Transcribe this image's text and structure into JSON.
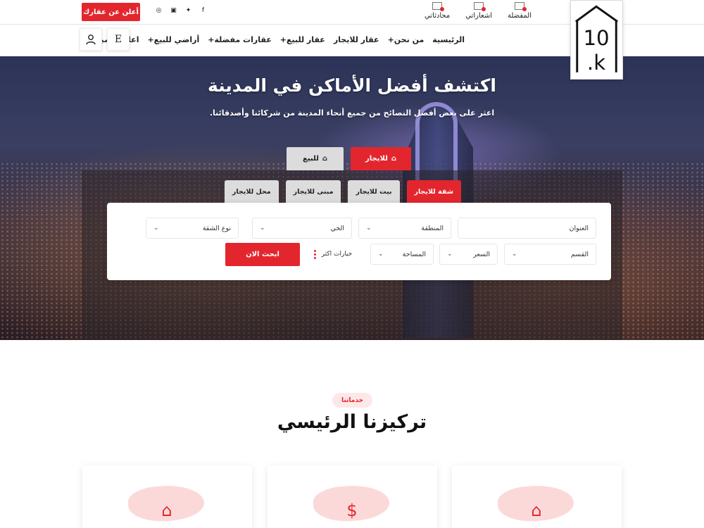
{
  "topbar": {
    "advertise_button": "أعلن عن عقارك",
    "links": [
      {
        "label": "المفضلة",
        "icon": "mail-icon"
      },
      {
        "label": "اشعاراتي",
        "icon": "mail-icon"
      },
      {
        "label": "محادثاتي",
        "icon": "mail-icon"
      }
    ],
    "social": [
      "facebook-icon",
      "twitter-icon",
      "instagram-icon",
      "dribbble-icon"
    ]
  },
  "logo": {
    "text": "10k."
  },
  "nav": {
    "items": [
      "الرئيسية",
      "من نحن+",
      "عقار للايجار",
      "عقار للبيع+",
      "عقارات مفضلة+",
      "أراضي للبيع+",
      "اعلانات مبوبة+"
    ],
    "e_button": "E"
  },
  "hero": {
    "title": "اكتشف أفضل الأماكن في المدينة",
    "subtitle": "اعثر على بعض أفضل النصائح من جميع أنحاء المدينة من شركائنا وأصدقائنا.",
    "main_tabs": {
      "rent": "للايجار",
      "sale": "للبيع"
    },
    "sub_tabs": [
      "شقة للايجار",
      "بيت للايجار",
      "مبنى للايجار",
      "محل للايجار"
    ],
    "fields": {
      "address": "العنوان",
      "area": "المنطقة",
      "district": "الحي",
      "apartment_type": "نوع الشقة",
      "section": "القسم",
      "price": "السعر",
      "space": "المساحة"
    },
    "more_options": "خيارات اكثر",
    "search_button": "ابحث الان"
  },
  "services": {
    "badge": "خدماتنا",
    "title": "تركيزنا الرئيسي"
  },
  "colors": {
    "accent": "#e3262d",
    "tab_inactive": "#dcdcdc"
  }
}
